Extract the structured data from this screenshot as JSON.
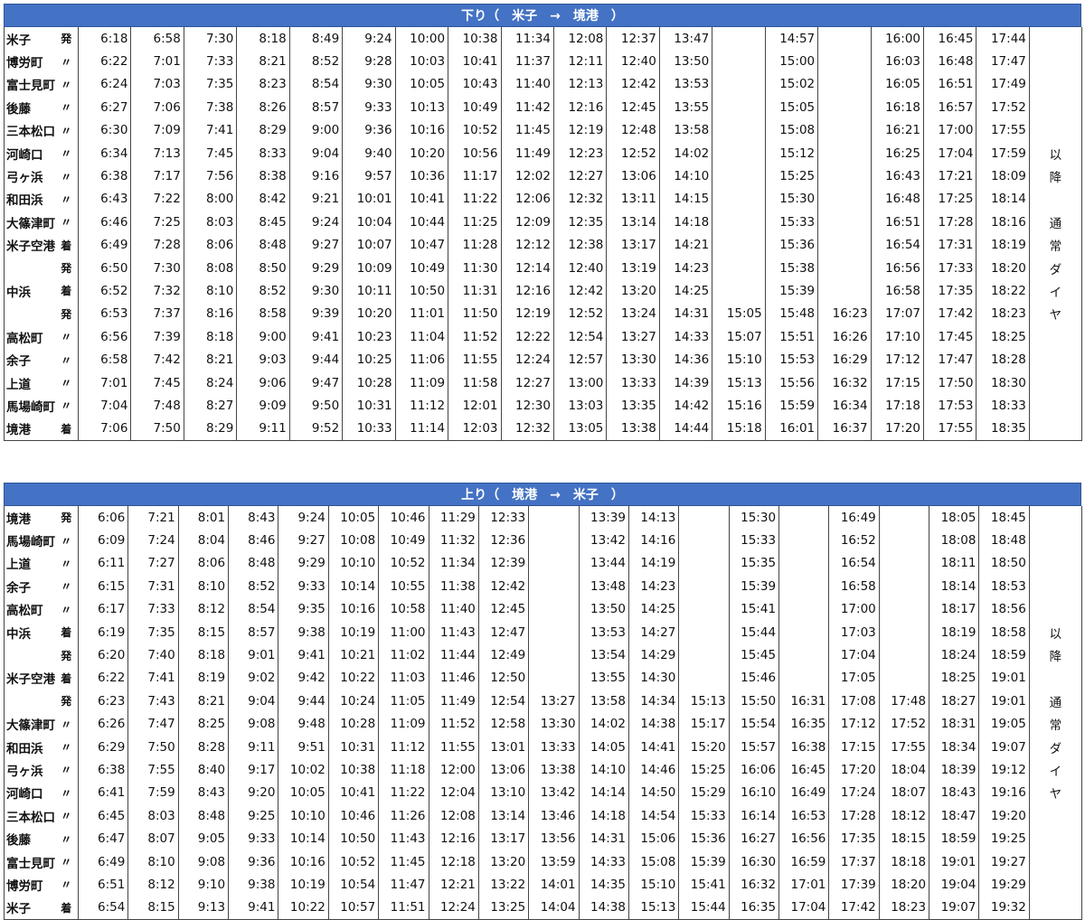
{
  "down": {
    "title": "下り（　米子　→　境港　）",
    "note": [
      "以",
      "降",
      "",
      "通",
      "常",
      "ダ",
      "イ",
      "ヤ"
    ],
    "rows": [
      {
        "station": "米子",
        "mark": "発",
        "times": [
          "6:18",
          "6:58",
          "7:30",
          "8:18",
          "8:49",
          "9:24",
          "10:00",
          "10:38",
          "11:34",
          "12:08",
          "12:37",
          "13:47",
          "",
          "14:57",
          "",
          "16:00",
          "16:45",
          "17:44"
        ]
      },
      {
        "station": "博労町",
        "mark": "〃",
        "times": [
          "6:22",
          "7:01",
          "7:33",
          "8:21",
          "8:52",
          "9:28",
          "10:03",
          "10:41",
          "11:37",
          "12:11",
          "12:40",
          "13:50",
          "",
          "15:00",
          "",
          "16:03",
          "16:48",
          "17:47"
        ]
      },
      {
        "station": "富士見町",
        "mark": "〃",
        "times": [
          "6:24",
          "7:03",
          "7:35",
          "8:23",
          "8:54",
          "9:30",
          "10:05",
          "10:43",
          "11:40",
          "12:13",
          "12:42",
          "13:53",
          "",
          "15:02",
          "",
          "16:05",
          "16:51",
          "17:49"
        ]
      },
      {
        "station": "後藤",
        "mark": "〃",
        "times": [
          "6:27",
          "7:06",
          "7:38",
          "8:26",
          "8:57",
          "9:33",
          "10:13",
          "10:49",
          "11:42",
          "12:16",
          "12:45",
          "13:55",
          "",
          "15:05",
          "",
          "16:18",
          "16:57",
          "17:52"
        ]
      },
      {
        "station": "三本松口",
        "mark": "〃",
        "times": [
          "6:30",
          "7:09",
          "7:41",
          "8:29",
          "9:00",
          "9:36",
          "10:16",
          "10:52",
          "11:45",
          "12:19",
          "12:48",
          "13:58",
          "",
          "15:08",
          "",
          "16:21",
          "17:00",
          "17:55"
        ]
      },
      {
        "station": "河崎口",
        "mark": "〃",
        "times": [
          "6:34",
          "7:13",
          "7:45",
          "8:33",
          "9:04",
          "9:40",
          "10:20",
          "10:56",
          "11:49",
          "12:23",
          "12:52",
          "14:02",
          "",
          "15:12",
          "",
          "16:25",
          "17:04",
          "17:59"
        ]
      },
      {
        "station": "弓ヶ浜",
        "mark": "〃",
        "times": [
          "6:38",
          "7:17",
          "7:56",
          "8:38",
          "9:16",
          "9:57",
          "10:36",
          "11:17",
          "12:02",
          "12:27",
          "13:06",
          "14:10",
          "",
          "15:25",
          "",
          "16:43",
          "17:21",
          "18:09"
        ]
      },
      {
        "station": "和田浜",
        "mark": "〃",
        "times": [
          "6:43",
          "7:22",
          "8:00",
          "8:42",
          "9:21",
          "10:01",
          "10:41",
          "11:22",
          "12:06",
          "12:32",
          "13:11",
          "14:15",
          "",
          "15:30",
          "",
          "16:48",
          "17:25",
          "18:14"
        ]
      },
      {
        "station": "大篠津町",
        "mark": "〃",
        "times": [
          "6:46",
          "7:25",
          "8:03",
          "8:45",
          "9:24",
          "10:04",
          "10:44",
          "11:25",
          "12:09",
          "12:35",
          "13:14",
          "14:18",
          "",
          "15:33",
          "",
          "16:51",
          "17:28",
          "18:16"
        ]
      },
      {
        "station": "米子空港",
        "mark": "着",
        "times": [
          "6:49",
          "7:28",
          "8:06",
          "8:48",
          "9:27",
          "10:07",
          "10:47",
          "11:28",
          "12:12",
          "12:38",
          "13:17",
          "14:21",
          "",
          "15:36",
          "",
          "16:54",
          "17:31",
          "18:19"
        ]
      },
      {
        "station": "",
        "mark": "発",
        "times": [
          "6:50",
          "7:30",
          "8:08",
          "8:50",
          "9:29",
          "10:09",
          "10:49",
          "11:30",
          "12:14",
          "12:40",
          "13:19",
          "14:23",
          "",
          "15:38",
          "",
          "16:56",
          "17:33",
          "18:20"
        ]
      },
      {
        "station": "中浜",
        "mark": "着",
        "times": [
          "6:52",
          "7:32",
          "8:10",
          "8:52",
          "9:30",
          "10:11",
          "10:50",
          "11:31",
          "12:16",
          "12:42",
          "13:20",
          "14:25",
          "",
          "15:39",
          "",
          "16:58",
          "17:35",
          "18:22"
        ]
      },
      {
        "station": "",
        "mark": "発",
        "times": [
          "6:53",
          "7:37",
          "8:16",
          "8:58",
          "9:39",
          "10:20",
          "11:01",
          "11:50",
          "12:19",
          "12:52",
          "13:24",
          "14:31",
          "15:05",
          "15:48",
          "16:23",
          "17:07",
          "17:42",
          "18:23"
        ]
      },
      {
        "station": "高松町",
        "mark": "〃",
        "times": [
          "6:56",
          "7:39",
          "8:18",
          "9:00",
          "9:41",
          "10:23",
          "11:04",
          "11:52",
          "12:22",
          "12:54",
          "13:27",
          "14:33",
          "15:07",
          "15:51",
          "16:26",
          "17:10",
          "17:45",
          "18:25"
        ]
      },
      {
        "station": "余子",
        "mark": "〃",
        "times": [
          "6:58",
          "7:42",
          "8:21",
          "9:03",
          "9:44",
          "10:25",
          "11:06",
          "11:55",
          "12:24",
          "12:57",
          "13:30",
          "14:36",
          "15:10",
          "15:53",
          "16:29",
          "17:12",
          "17:47",
          "18:28"
        ]
      },
      {
        "station": "上道",
        "mark": "〃",
        "times": [
          "7:01",
          "7:45",
          "8:24",
          "9:06",
          "9:47",
          "10:28",
          "11:09",
          "11:58",
          "12:27",
          "13:00",
          "13:33",
          "14:39",
          "15:13",
          "15:56",
          "16:32",
          "17:15",
          "17:50",
          "18:30"
        ]
      },
      {
        "station": "馬場崎町",
        "mark": "〃",
        "times": [
          "7:04",
          "7:48",
          "8:27",
          "9:09",
          "9:50",
          "10:31",
          "11:12",
          "12:01",
          "12:30",
          "13:03",
          "13:35",
          "14:42",
          "15:16",
          "15:59",
          "16:34",
          "17:18",
          "17:53",
          "18:33"
        ]
      },
      {
        "station": "境港",
        "mark": "着",
        "times": [
          "7:06",
          "7:50",
          "8:29",
          "9:11",
          "9:52",
          "10:33",
          "11:14",
          "12:03",
          "12:32",
          "13:05",
          "13:38",
          "14:44",
          "15:18",
          "16:01",
          "16:37",
          "17:20",
          "17:55",
          "18:35"
        ]
      }
    ]
  },
  "up": {
    "title": "上り（　境港　→　米子　）",
    "note": [
      "以",
      "降",
      "",
      "通",
      "常",
      "ダ",
      "イ",
      "ヤ"
    ],
    "rows": [
      {
        "station": "境港",
        "mark": "発",
        "times": [
          "6:06",
          "7:21",
          "8:01",
          "8:43",
          "9:24",
          "10:05",
          "10:46",
          "11:29",
          "12:33",
          "",
          "13:39",
          "14:13",
          "",
          "15:30",
          "",
          "16:49",
          "",
          "18:05",
          "18:45"
        ]
      },
      {
        "station": "馬場崎町",
        "mark": "〃",
        "times": [
          "6:09",
          "7:24",
          "8:04",
          "8:46",
          "9:27",
          "10:08",
          "10:49",
          "11:32",
          "12:36",
          "",
          "13:42",
          "14:16",
          "",
          "15:33",
          "",
          "16:52",
          "",
          "18:08",
          "18:48"
        ]
      },
      {
        "station": "上道",
        "mark": "〃",
        "times": [
          "6:11",
          "7:27",
          "8:06",
          "8:48",
          "9:29",
          "10:10",
          "10:52",
          "11:34",
          "12:39",
          "",
          "13:44",
          "14:19",
          "",
          "15:35",
          "",
          "16:54",
          "",
          "18:11",
          "18:50"
        ]
      },
      {
        "station": "余子",
        "mark": "〃",
        "times": [
          "6:15",
          "7:31",
          "8:10",
          "8:52",
          "9:33",
          "10:14",
          "10:55",
          "11:38",
          "12:42",
          "",
          "13:48",
          "14:23",
          "",
          "15:39",
          "",
          "16:58",
          "",
          "18:14",
          "18:53"
        ]
      },
      {
        "station": "高松町",
        "mark": "〃",
        "times": [
          "6:17",
          "7:33",
          "8:12",
          "8:54",
          "9:35",
          "10:16",
          "10:58",
          "11:40",
          "12:45",
          "",
          "13:50",
          "14:25",
          "",
          "15:41",
          "",
          "17:00",
          "",
          "18:17",
          "18:56"
        ]
      },
      {
        "station": "中浜",
        "mark": "着",
        "times": [
          "6:19",
          "7:35",
          "8:15",
          "8:57",
          "9:38",
          "10:19",
          "11:00",
          "11:43",
          "12:47",
          "",
          "13:53",
          "14:27",
          "",
          "15:44",
          "",
          "17:03",
          "",
          "18:19",
          "18:58"
        ]
      },
      {
        "station": "",
        "mark": "発",
        "times": [
          "6:20",
          "7:40",
          "8:18",
          "9:01",
          "9:41",
          "10:21",
          "11:02",
          "11:44",
          "12:49",
          "",
          "13:54",
          "14:29",
          "",
          "15:45",
          "",
          "17:04",
          "",
          "18:24",
          "18:59"
        ]
      },
      {
        "station": "米子空港",
        "mark": "着",
        "times": [
          "6:22",
          "7:41",
          "8:19",
          "9:02",
          "9:42",
          "10:22",
          "11:03",
          "11:46",
          "12:50",
          "",
          "13:55",
          "14:30",
          "",
          "15:46",
          "",
          "17:05",
          "",
          "18:25",
          "19:01"
        ]
      },
      {
        "station": "",
        "mark": "発",
        "times": [
          "6:23",
          "7:43",
          "8:21",
          "9:04",
          "9:44",
          "10:24",
          "11:05",
          "11:49",
          "12:54",
          "13:27",
          "13:58",
          "14:34",
          "15:13",
          "15:50",
          "16:31",
          "17:08",
          "17:48",
          "18:27",
          "19:01"
        ]
      },
      {
        "station": "大篠津町",
        "mark": "〃",
        "times": [
          "6:26",
          "7:47",
          "8:25",
          "9:08",
          "9:48",
          "10:28",
          "11:09",
          "11:52",
          "12:58",
          "13:30",
          "14:02",
          "14:38",
          "15:17",
          "15:54",
          "16:35",
          "17:12",
          "17:52",
          "18:31",
          "19:05"
        ]
      },
      {
        "station": "和田浜",
        "mark": "〃",
        "times": [
          "6:29",
          "7:50",
          "8:28",
          "9:11",
          "9:51",
          "10:31",
          "11:12",
          "11:55",
          "13:01",
          "13:33",
          "14:05",
          "14:41",
          "15:20",
          "15:57",
          "16:38",
          "17:15",
          "17:55",
          "18:34",
          "19:07"
        ]
      },
      {
        "station": "弓ヶ浜",
        "mark": "〃",
        "times": [
          "6:38",
          "7:55",
          "8:40",
          "9:17",
          "10:02",
          "10:38",
          "11:18",
          "12:00",
          "13:06",
          "13:38",
          "14:10",
          "14:46",
          "15:25",
          "16:06",
          "16:45",
          "17:20",
          "18:04",
          "18:39",
          "19:12"
        ]
      },
      {
        "station": "河崎口",
        "mark": "〃",
        "times": [
          "6:41",
          "7:59",
          "8:43",
          "9:20",
          "10:05",
          "10:41",
          "11:22",
          "12:04",
          "13:10",
          "13:42",
          "14:14",
          "14:50",
          "15:29",
          "16:10",
          "16:49",
          "17:24",
          "18:07",
          "18:43",
          "19:16"
        ]
      },
      {
        "station": "三本松口",
        "mark": "〃",
        "times": [
          "6:45",
          "8:03",
          "8:48",
          "9:25",
          "10:10",
          "10:46",
          "11:26",
          "12:08",
          "13:14",
          "13:46",
          "14:18",
          "14:54",
          "15:33",
          "16:14",
          "16:53",
          "17:28",
          "18:12",
          "18:47",
          "19:20"
        ]
      },
      {
        "station": "後藤",
        "mark": "〃",
        "times": [
          "6:47",
          "8:07",
          "9:05",
          "9:33",
          "10:14",
          "10:50",
          "11:43",
          "12:16",
          "13:17",
          "13:56",
          "14:31",
          "15:06",
          "15:36",
          "16:27",
          "16:56",
          "17:35",
          "18:15",
          "18:59",
          "19:25"
        ]
      },
      {
        "station": "富士見町",
        "mark": "〃",
        "times": [
          "6:49",
          "8:10",
          "9:08",
          "9:36",
          "10:16",
          "10:52",
          "11:45",
          "12:18",
          "13:20",
          "13:59",
          "14:33",
          "15:08",
          "15:39",
          "16:30",
          "16:59",
          "17:37",
          "18:18",
          "19:01",
          "19:27"
        ]
      },
      {
        "station": "博労町",
        "mark": "〃",
        "times": [
          "6:51",
          "8:12",
          "9:10",
          "9:38",
          "10:19",
          "10:54",
          "11:47",
          "12:21",
          "13:22",
          "14:01",
          "14:35",
          "15:10",
          "15:41",
          "16:32",
          "17:01",
          "17:39",
          "18:20",
          "19:04",
          "19:29"
        ]
      },
      {
        "station": "米子",
        "mark": "着",
        "times": [
          "6:54",
          "8:15",
          "9:13",
          "9:41",
          "10:22",
          "10:57",
          "11:51",
          "12:24",
          "13:25",
          "14:04",
          "14:38",
          "15:13",
          "15:44",
          "16:35",
          "17:04",
          "17:42",
          "18:23",
          "19:07",
          "19:32"
        ]
      }
    ]
  }
}
